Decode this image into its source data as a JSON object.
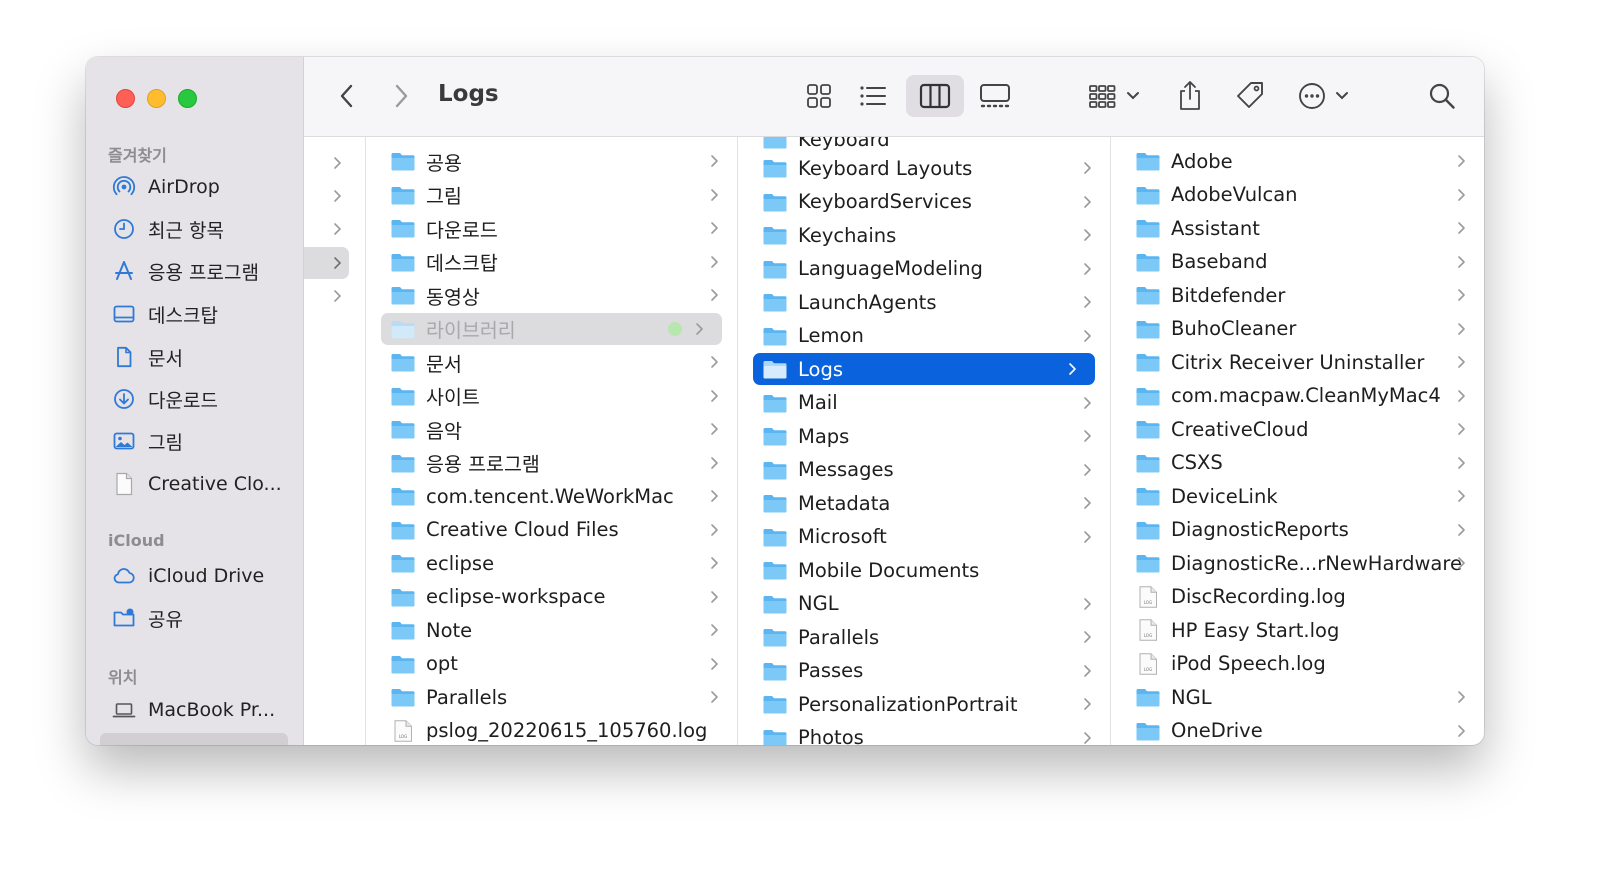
{
  "toolbar": {
    "title": "Logs"
  },
  "sidebar": {
    "favorites_label": "즐겨찾기",
    "favorites": [
      {
        "label": "AirDrop",
        "icon": "airdrop-icon"
      },
      {
        "label": "최근 항목",
        "icon": "clock-icon"
      },
      {
        "label": "응용 프로그램",
        "icon": "applications-icon"
      },
      {
        "label": "데스크탑",
        "icon": "desktop-icon"
      },
      {
        "label": "문서",
        "icon": "document-icon"
      },
      {
        "label": "다운로드",
        "icon": "download-icon"
      },
      {
        "label": "그림",
        "icon": "pictures-icon"
      },
      {
        "label": "Creative Clo...",
        "icon": "file-icon"
      }
    ],
    "icloud_label": "iCloud",
    "icloud": [
      {
        "label": "iCloud Drive",
        "icon": "cloud-icon"
      },
      {
        "label": "공유",
        "icon": "shared-folder-icon"
      }
    ],
    "locations_label": "위치",
    "locations": [
      {
        "label": "MacBook Pr...",
        "icon": "laptop-icon"
      }
    ]
  },
  "column_home": {
    "items": [
      {
        "label": "공용"
      },
      {
        "label": "그림"
      },
      {
        "label": "다운로드"
      },
      {
        "label": "데스크탑"
      },
      {
        "label": "동영상"
      },
      {
        "label": "라이브러리"
      },
      {
        "label": "문서"
      },
      {
        "label": "사이트"
      },
      {
        "label": "음악"
      },
      {
        "label": "응용 프로그램"
      },
      {
        "label": "com.tencent.WeWorkMac"
      },
      {
        "label": "Creative Cloud Files"
      },
      {
        "label": "eclipse"
      },
      {
        "label": "eclipse-workspace"
      },
      {
        "label": "Note"
      },
      {
        "label": "opt"
      },
      {
        "label": "Parallels"
      },
      {
        "label": "pslog_20220615_105760.log"
      }
    ]
  },
  "column_library": {
    "partial_top": "Keyboard",
    "items": [
      {
        "label": "Keyboard Layouts"
      },
      {
        "label": "KeyboardServices"
      },
      {
        "label": "Keychains"
      },
      {
        "label": "LanguageModeling"
      },
      {
        "label": "LaunchAgents"
      },
      {
        "label": "Lemon"
      },
      {
        "label": "Logs"
      },
      {
        "label": "Mail"
      },
      {
        "label": "Maps"
      },
      {
        "label": "Messages"
      },
      {
        "label": "Metadata"
      },
      {
        "label": "Microsoft"
      },
      {
        "label": "Mobile Documents"
      },
      {
        "label": "NGL"
      },
      {
        "label": "Parallels"
      },
      {
        "label": "Passes"
      },
      {
        "label": "PersonalizationPortrait"
      },
      {
        "label": "Photos"
      }
    ]
  },
  "column_logs": {
    "items": [
      {
        "label": "Adobe"
      },
      {
        "label": "AdobeVulcan"
      },
      {
        "label": "Assistant"
      },
      {
        "label": "Baseband"
      },
      {
        "label": "Bitdefender"
      },
      {
        "label": "BuhoCleaner"
      },
      {
        "label": "Citrix Receiver Uninstaller"
      },
      {
        "label": "com.macpaw.CleanMyMac4"
      },
      {
        "label": "CreativeCloud"
      },
      {
        "label": "CSXS"
      },
      {
        "label": "DeviceLink"
      },
      {
        "label": "DiagnosticReports"
      },
      {
        "label": "DiagnosticRe...rNewHardware"
      },
      {
        "label": "DiscRecording.log"
      },
      {
        "label": "HP Easy Start.log"
      },
      {
        "label": "iPod Speech.log"
      },
      {
        "label": "NGL"
      },
      {
        "label": "OneDrive"
      }
    ]
  },
  "colors": {
    "selection_blue": "#0a63dc",
    "folder_blue": "#5ab5f0",
    "sidebar_icon": "#2f7ad6"
  }
}
